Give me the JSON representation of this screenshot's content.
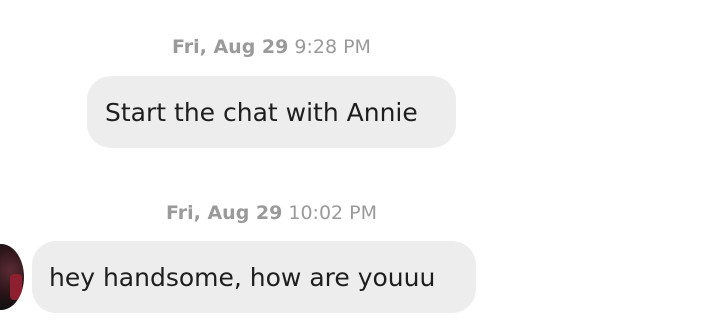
{
  "messages": [
    {
      "date": "Fri, Aug 29",
      "time": "9:28 PM",
      "text": "Start the chat with Annie"
    },
    {
      "date": "Fri, Aug 29",
      "time": "10:02 PM",
      "text": "hey handsome, how are youuu"
    }
  ]
}
